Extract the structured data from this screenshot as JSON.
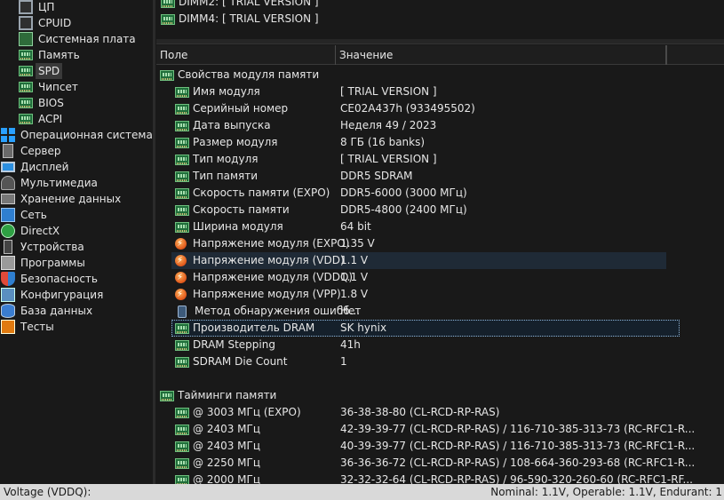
{
  "tree": {
    "items": [
      {
        "label": "ЦП",
        "icon": "cpu-icon",
        "level": "sub"
      },
      {
        "label": "CPUID",
        "icon": "cpuid-icon",
        "level": "sub"
      },
      {
        "label": "Системная плата",
        "icon": "motherboard-icon",
        "level": "sub"
      },
      {
        "label": "Память",
        "icon": "memory-icon",
        "level": "sub"
      },
      {
        "label": "SPD",
        "icon": "spd-icon",
        "level": "sub",
        "selected": true
      },
      {
        "label": "Чипсет",
        "icon": "chipset-icon",
        "level": "sub"
      },
      {
        "label": "BIOS",
        "icon": "bios-icon",
        "level": "sub"
      },
      {
        "label": "ACPI",
        "icon": "acpi-icon",
        "level": "sub"
      },
      {
        "label": "Операционная система",
        "icon": "windows-icon",
        "level": "top"
      },
      {
        "label": "Сервер",
        "icon": "server-icon",
        "level": "top"
      },
      {
        "label": "Дисплей",
        "icon": "monitor-icon",
        "level": "top"
      },
      {
        "label": "Мультимедиа",
        "icon": "multimedia-icon",
        "level": "top"
      },
      {
        "label": "Хранение данных",
        "icon": "storage-icon",
        "level": "top"
      },
      {
        "label": "Сеть",
        "icon": "network-icon",
        "level": "top"
      },
      {
        "label": "DirectX",
        "icon": "xbox-icon",
        "level": "top"
      },
      {
        "label": "Устройства",
        "icon": "devices-icon",
        "level": "top"
      },
      {
        "label": "Программы",
        "icon": "programs-icon",
        "level": "top"
      },
      {
        "label": "Безопасность",
        "icon": "security-shield-icon",
        "level": "top"
      },
      {
        "label": "Конфигурация",
        "icon": "configuration-icon",
        "level": "top"
      },
      {
        "label": "База данных",
        "icon": "database-icon",
        "level": "top"
      },
      {
        "label": "Тесты",
        "icon": "benchmark-icon",
        "level": "top"
      }
    ]
  },
  "toplist": {
    "items": [
      "DIMM2: [ TRIAL VERSION ]",
      "DIMM4: [ TRIAL VERSION ]"
    ]
  },
  "grid": {
    "headers": {
      "field": "Поле",
      "value": "Значение"
    },
    "rows": [
      {
        "type": "section",
        "field": "Свойства модуля памяти",
        "value": "",
        "icon": "memory-module-icon"
      },
      {
        "type": "item",
        "field": "Имя модуля",
        "value": "[ TRIAL VERSION ]",
        "icon": "memory-module-icon"
      },
      {
        "type": "item",
        "field": "Серийный номер",
        "value": "CE02A437h (933495502)",
        "icon": "memory-module-icon"
      },
      {
        "type": "item",
        "field": "Дата выпуска",
        "value": "Неделя 49 / 2023",
        "icon": "memory-module-icon"
      },
      {
        "type": "item",
        "field": "Размер модуля",
        "value": "8 ГБ (16 banks)",
        "icon": "memory-module-icon"
      },
      {
        "type": "item",
        "field": "Тип модуля",
        "value": "[ TRIAL VERSION ]",
        "icon": "memory-module-icon"
      },
      {
        "type": "item",
        "field": "Тип памяти",
        "value": "DDR5 SDRAM",
        "icon": "memory-module-icon"
      },
      {
        "type": "item",
        "field": "Скорость памяти (EXPO)",
        "value": "DDR5-6000 (3000 МГц)",
        "icon": "memory-module-icon"
      },
      {
        "type": "item",
        "field": "Скорость памяти",
        "value": "DDR5-4800 (2400 МГц)",
        "icon": "memory-module-icon"
      },
      {
        "type": "item",
        "field": "Ширина модуля",
        "value": "64 bit",
        "icon": "memory-module-icon"
      },
      {
        "type": "item",
        "field": "Напряжение модуля (EXPO)",
        "value": "1.35 V",
        "icon": "voltage-icon"
      },
      {
        "type": "item",
        "field": "Напряжение модуля (VDD)",
        "value": "1.1 V",
        "icon": "voltage-icon",
        "highlight": true
      },
      {
        "type": "item",
        "field": "Напряжение модуля (VDDQ)",
        "value": "1.1 V",
        "icon": "voltage-icon"
      },
      {
        "type": "item",
        "field": "Напряжение модуля (VPP)",
        "value": "1.8 V",
        "icon": "voltage-icon"
      },
      {
        "type": "item",
        "field": "Метод обнаружения ошибб...",
        "value": "Нет",
        "icon": "device-icon"
      },
      {
        "type": "item",
        "field": "Производитель DRAM",
        "value": "SK hynix",
        "icon": "memory-module-icon",
        "focus": true
      },
      {
        "type": "item",
        "field": "DRAM Stepping",
        "value": "41h",
        "icon": "memory-module-icon"
      },
      {
        "type": "item",
        "field": "SDRAM Die Count",
        "value": "1",
        "icon": "memory-module-icon"
      },
      {
        "type": "blank",
        "field": "",
        "value": ""
      },
      {
        "type": "section",
        "field": "Тайминги памяти",
        "value": "",
        "icon": "memory-module-icon"
      },
      {
        "type": "item",
        "field": "@ 3003 МГц (EXPO)",
        "value": "36-38-38-80  (CL-RCD-RP-RAS)",
        "icon": "memory-module-icon"
      },
      {
        "type": "item",
        "field": "@ 2403 МГц",
        "value": "42-39-39-77  (CL-RCD-RP-RAS) / 116-710-385-313-73  (RC-RFC1-R...",
        "icon": "memory-module-icon"
      },
      {
        "type": "item",
        "field": "@ 2403 МГц",
        "value": "40-39-39-77  (CL-RCD-RP-RAS) / 116-710-385-313-73  (RC-RFC1-R...",
        "icon": "memory-module-icon"
      },
      {
        "type": "item",
        "field": "@ 2250 МГц",
        "value": "36-36-36-72  (CL-RCD-RP-RAS) / 108-664-360-293-68  (RC-RFC1-R...",
        "icon": "memory-module-icon"
      },
      {
        "type": "item",
        "field": "@ 2000 МГц",
        "value": "32-32-32-64  (CL-RCD-RP-RAS) / 96-590-320-260-60  (RC-RFC1-RF...",
        "icon": "memory-module-icon"
      }
    ]
  },
  "statusbar": {
    "left": "Voltage (VDDQ):",
    "right": "Nominal: 1.1V, Operable: 1.1V, Endurant: 1"
  }
}
